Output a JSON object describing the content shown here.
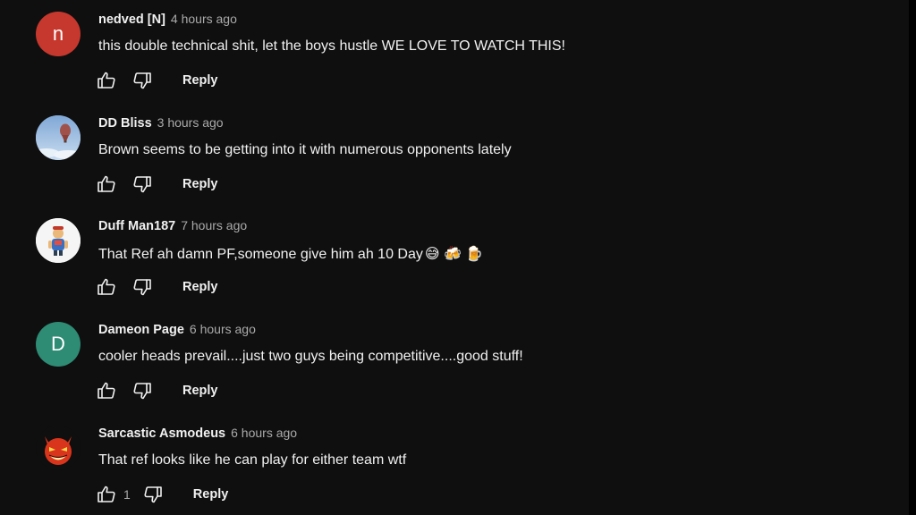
{
  "comments": [
    {
      "author": "nedved [N]",
      "time": "4 hours ago",
      "text": "this double technical shit, let the boys hustle WE LOVE TO WATCH THIS!",
      "emojis": "",
      "avatar_letter": "n",
      "avatar_color": "#c6382e",
      "likes": "",
      "reply_label": "Reply"
    },
    {
      "author": "DD Bliss",
      "time": "3 hours ago",
      "text": "Brown seems to be getting into it with numerous opponents lately",
      "emojis": "",
      "avatar_letter": "",
      "avatar_color": "#8fb3d9",
      "likes": "",
      "reply_label": "Reply"
    },
    {
      "author": "Duff Man187",
      "time": "7 hours ago",
      "text": "That Ref ah damn PF,someone give him ah 10 Day",
      "emojis": "😅 🍻 🍺",
      "avatar_letter": "",
      "avatar_color": "#f5f5f5",
      "likes": "",
      "reply_label": "Reply"
    },
    {
      "author": "Dameon Page",
      "time": "6 hours ago",
      "text": "cooler heads prevail....just two guys being competitive....good stuff!",
      "emojis": "",
      "avatar_letter": "D",
      "avatar_color": "#2e8b74",
      "likes": "",
      "reply_label": "Reply"
    },
    {
      "author": "Sarcastic Asmodeus",
      "time": "6 hours ago",
      "text": "That ref looks like he can play for either team wtf",
      "emojis": "",
      "avatar_letter": "",
      "avatar_color": "#1a0d0d",
      "likes": "1",
      "reply_label": "Reply"
    }
  ],
  "icons": {
    "like": "thumbs-up-icon",
    "dislike": "thumbs-down-icon"
  },
  "colors": {
    "background": "#0f0f0f",
    "text": "#f1f1f1",
    "secondary_text": "#aaaaaa"
  }
}
